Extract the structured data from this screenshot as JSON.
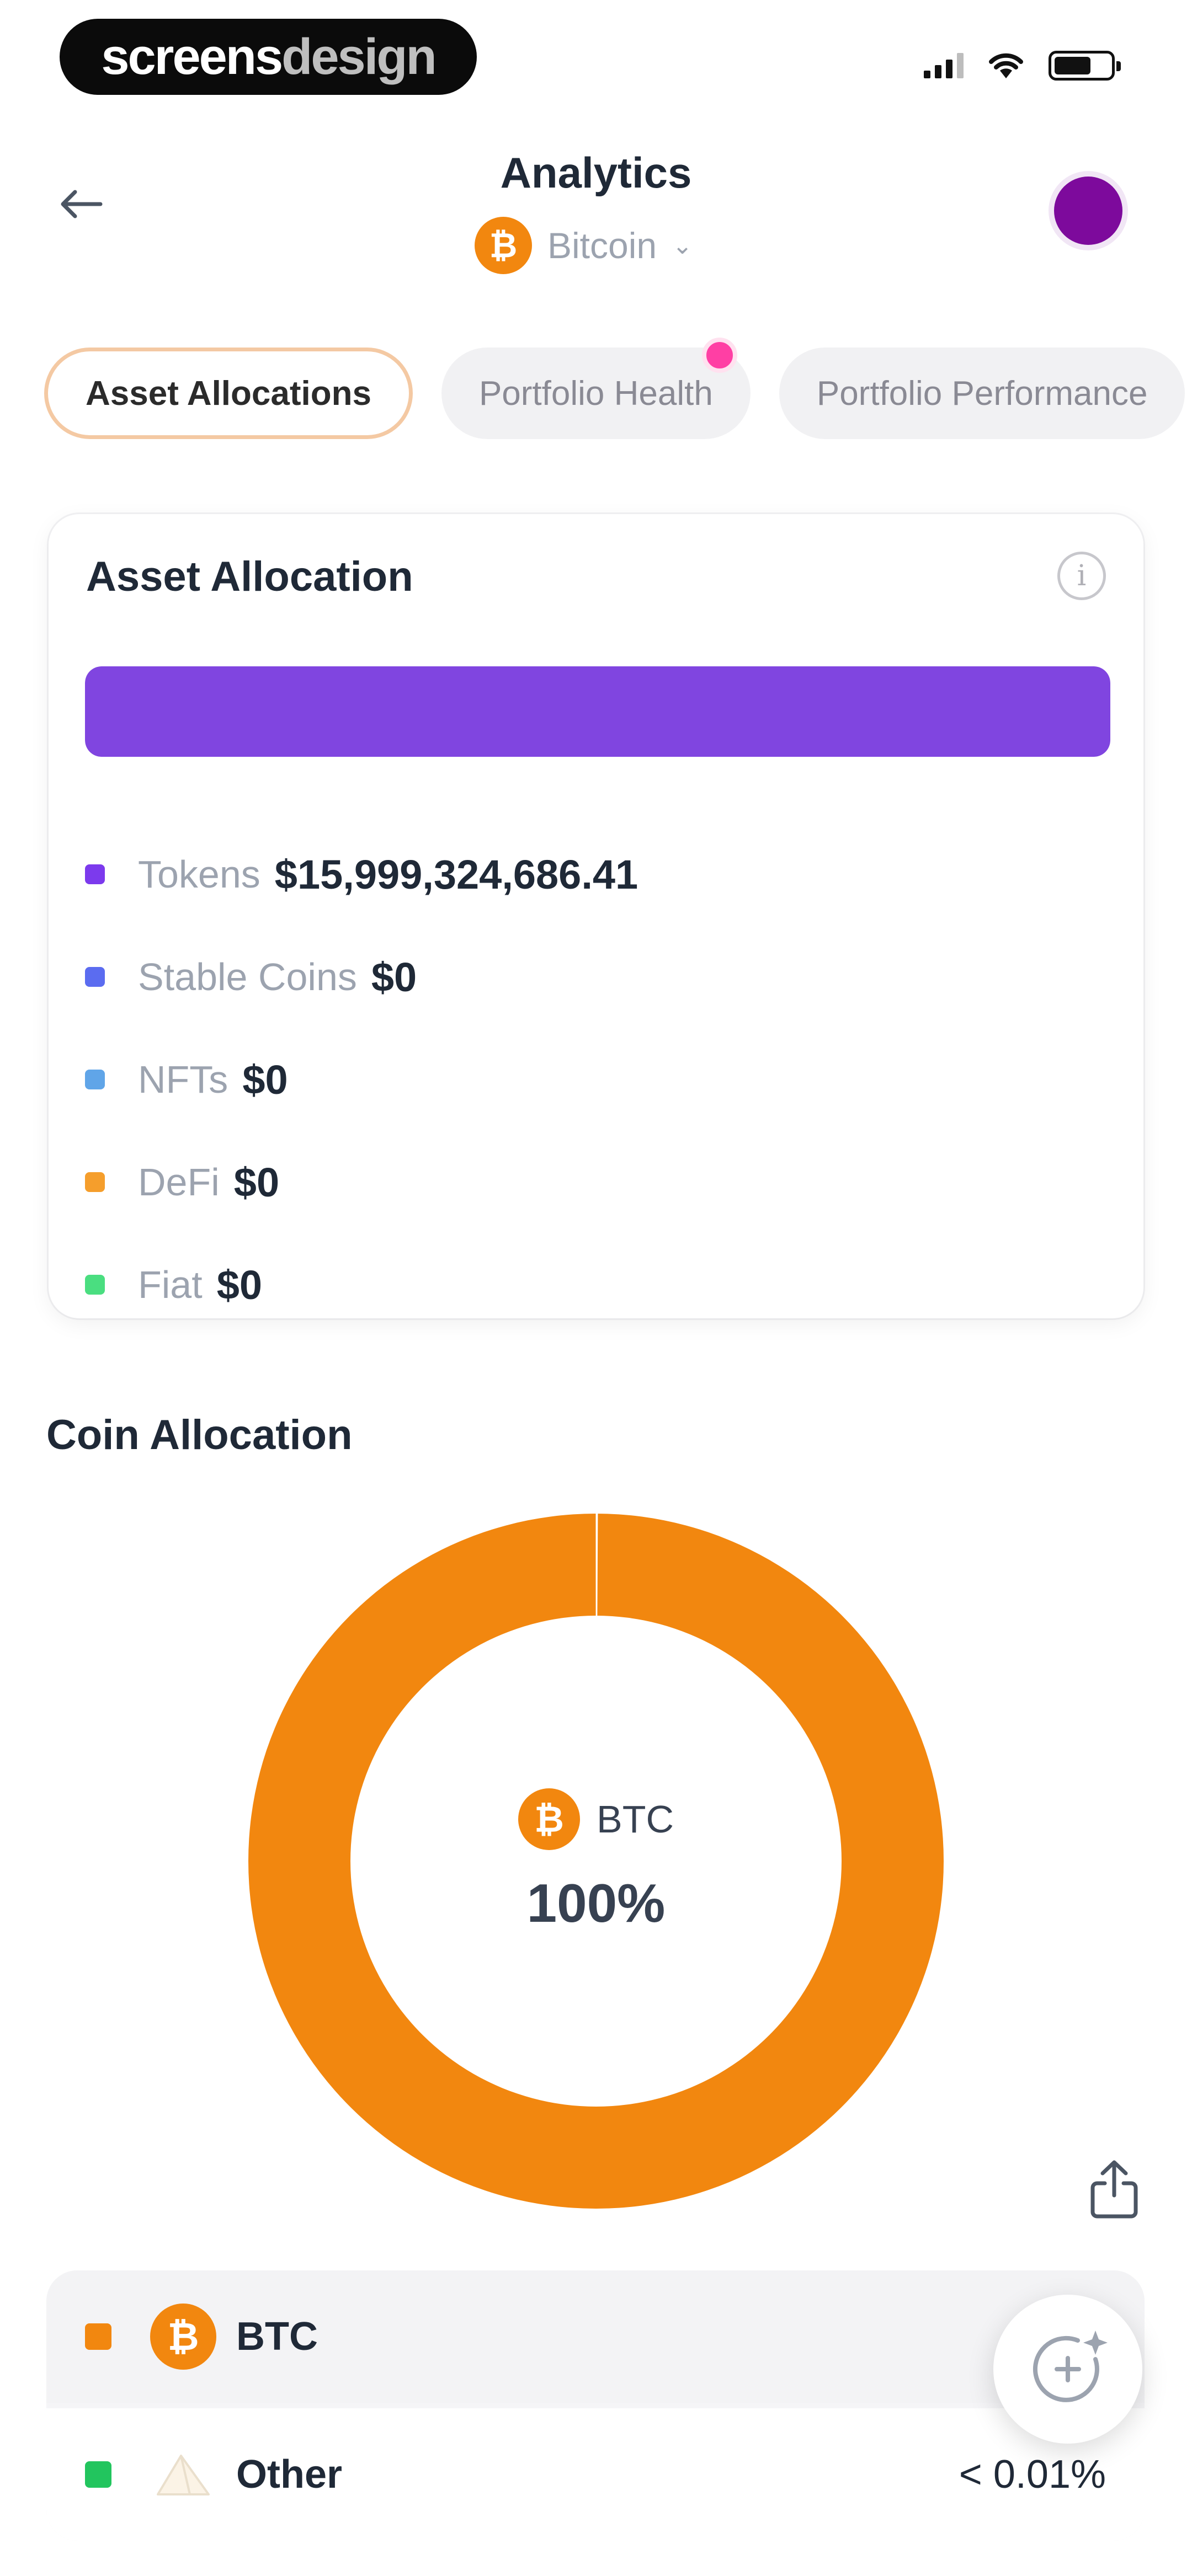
{
  "status_bar": {
    "brand_part1": "screens",
    "brand_part2": "design"
  },
  "header": {
    "title": "Analytics",
    "coin_selector": {
      "symbol": "₿",
      "name": "Bitcoin",
      "chevron": "⌄"
    }
  },
  "tabs": [
    {
      "label": "Asset Allocations",
      "active": true
    },
    {
      "label": "Portfolio Health",
      "active": false,
      "badge": true
    },
    {
      "label": "Portfolio Performance",
      "active": false
    }
  ],
  "asset_allocation": {
    "title": "Asset Allocation",
    "info_symbol": "i",
    "bar_segments": [
      {
        "name": "Tokens",
        "fraction": 1.0,
        "color": "#8045e0"
      }
    ],
    "items": [
      {
        "label": "Tokens",
        "value": "$15,999,324,686.41",
        "color": "#7c3aed"
      },
      {
        "label": "Stable Coins",
        "value": "$0",
        "color": "#5b6cf0"
      },
      {
        "label": "NFTs",
        "value": "$0",
        "color": "#60a5e8"
      },
      {
        "label": "DeFi",
        "value": "$0",
        "color": "#f59e2c"
      },
      {
        "label": "Fiat",
        "value": "$0",
        "color": "#4ade80"
      }
    ]
  },
  "coin_allocation": {
    "title": "Coin Allocation",
    "center": {
      "symbol": "BTC",
      "coin_glyph": "₿",
      "percent": "100%"
    },
    "coins": [
      {
        "symbol": "BTC",
        "glyph": "₿",
        "value": "",
        "color": "#f2870f",
        "icon": "bitcoin-icon"
      },
      {
        "symbol": "Other",
        "glyph": "",
        "value": "< 0.01%",
        "color": "#22c55e",
        "icon": "other-coins-icon"
      }
    ]
  },
  "chart_data": {
    "type": "pie",
    "title": "Coin Allocation",
    "categories": [
      "BTC",
      "Other"
    ],
    "values": [
      99.99,
      0.01
    ],
    "colors": [
      "#f2870f",
      "#ffffff"
    ]
  },
  "colors": {
    "accent_orange": "#f2870f",
    "asset_purple": "#8045e0",
    "avatar": "#7d0a9c",
    "badge_pink": "#ff3fa4"
  }
}
